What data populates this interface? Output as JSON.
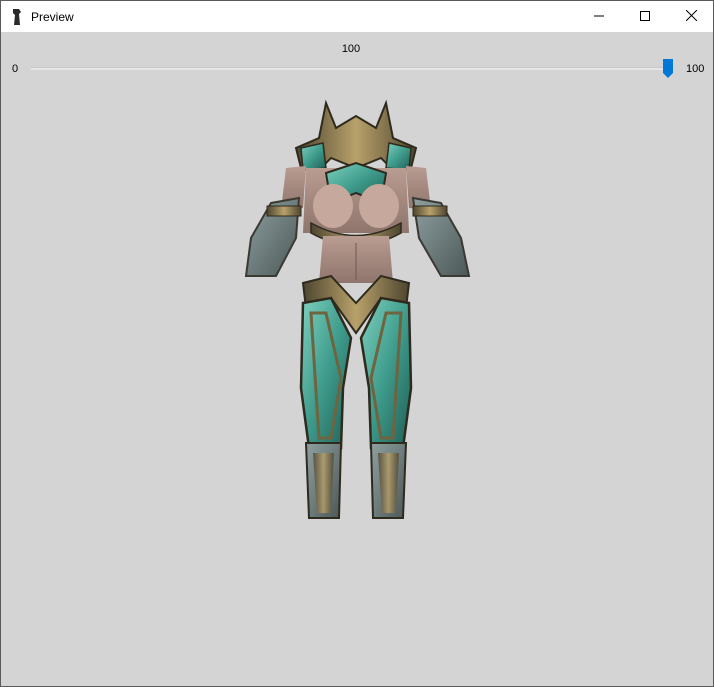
{
  "window": {
    "title": "Preview",
    "controls": {
      "minimize_icon": "minimize-icon",
      "maximize_icon": "maximize-icon",
      "close_icon": "close-icon"
    }
  },
  "slider": {
    "current_value": "100",
    "min_label": "0",
    "max_label": "100",
    "level": 1.0,
    "accent_color": "#0078d7"
  },
  "preview": {
    "subject": "3d-armor-body-preview"
  },
  "colors": {
    "background": "#d4d4d4",
    "titlebar": "#ffffff",
    "accent": "#0078d7"
  }
}
